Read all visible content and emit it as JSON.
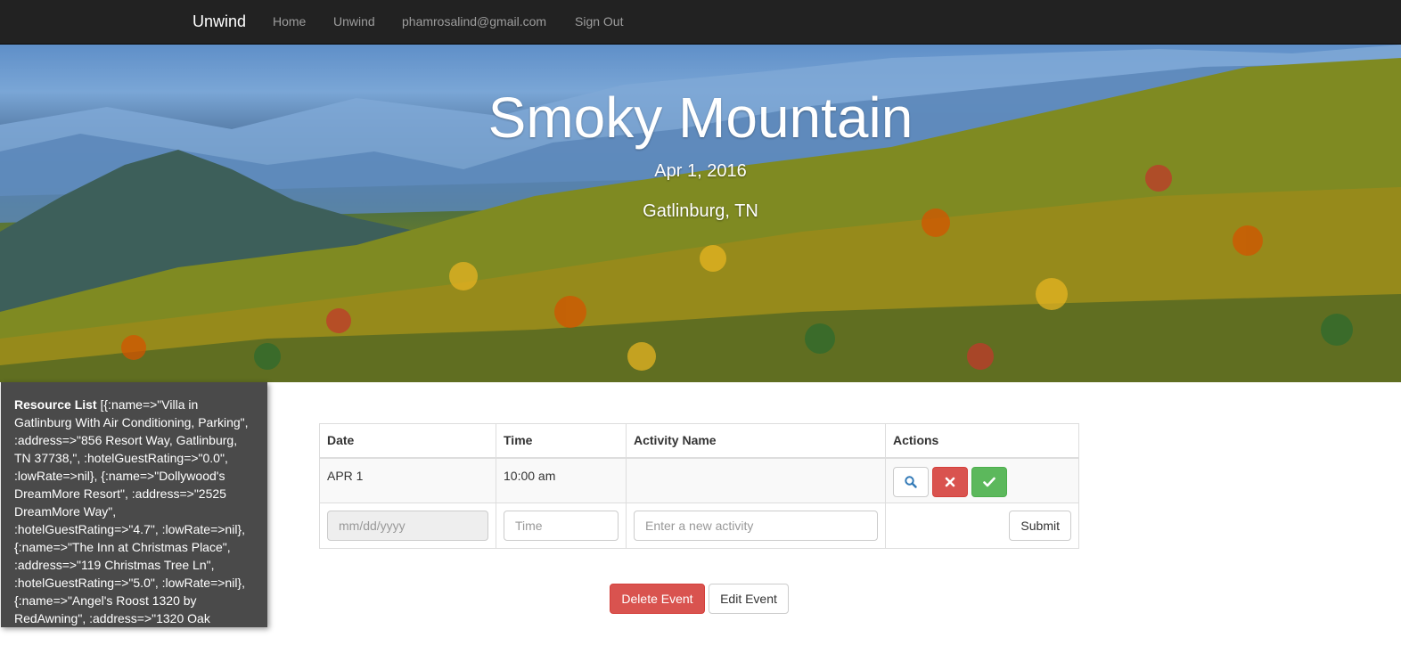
{
  "navbar": {
    "brand": "Unwind",
    "links": [
      "Home",
      "Unwind",
      "phamrosalind@gmail.com",
      "Sign Out"
    ]
  },
  "hero": {
    "title": "Smoky Mountain",
    "date": "Apr 1, 2016",
    "location": "Gatlinburg, TN"
  },
  "resource_panel": {
    "label": "Resource List",
    "text": " [{:name=>\"Villa in Gatlinburg With Air Conditioning, Parking\", :address=>\"856 Resort Way, Gatlinburg, TN 37738,\", :hotelGuestRating=>\"0.0\", :lowRate=>nil}, {:name=>\"Dollywood's DreamMore Resort\", :address=>\"2525 DreamMore Way\", :hotelGuestRating=>\"4.7\", :lowRate=>nil}, {:name=>\"The Inn at Christmas Place\", :address=>\"119 Christmas Tree Ln\", :hotelGuestRating=>\"5.0\", :lowRate=>nil}, {:name=>\"Angel's Roost 1320 by RedAwning\", :address=>\"1320 Oak"
  },
  "table": {
    "headers": [
      "Date",
      "Time",
      "Activity Name",
      "Actions"
    ],
    "rows": [
      {
        "date": "APR 1",
        "time": "10:00 am",
        "activity": ""
      }
    ],
    "new_row": {
      "date_placeholder": "mm/dd/yyyy",
      "time_placeholder": "Time",
      "activity_placeholder": "Enter a new activity",
      "submit_label": "Submit"
    }
  },
  "event_actions": {
    "delete_label": "Delete Event",
    "edit_label": "Edit Event"
  },
  "colors": {
    "navbar": "#222222",
    "danger": "#d9534f",
    "success": "#5cb85c",
    "panel": "#4a4a4a"
  },
  "icons": [
    "search-icon",
    "remove-icon",
    "check-icon"
  ]
}
